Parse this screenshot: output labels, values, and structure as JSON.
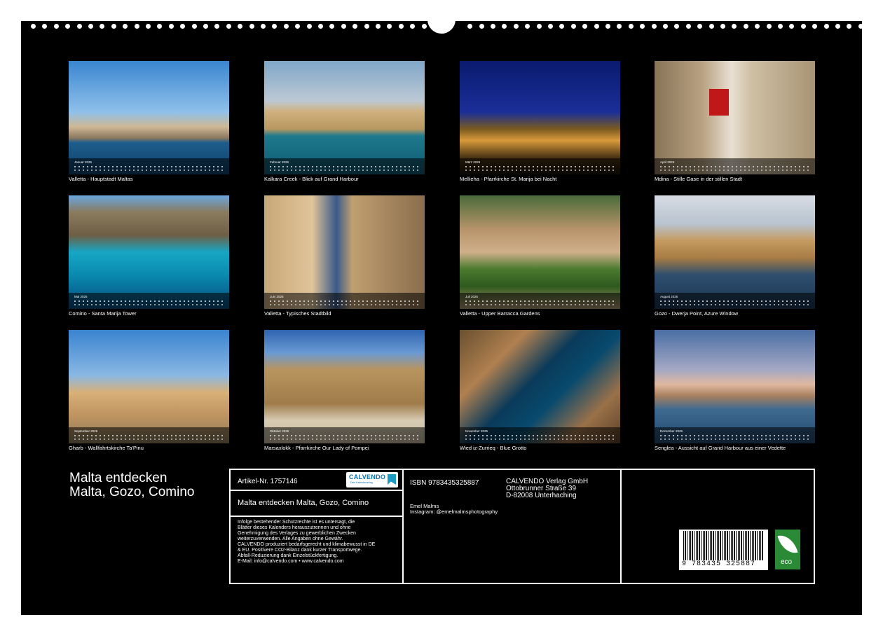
{
  "calendar": {
    "title_line1": "Malta entdecken",
    "title_line2": "Malta, Gozo, Comino",
    "images": [
      {
        "month": "Januar 2025",
        "caption": "Valletta - Hauptstadt Maltas"
      },
      {
        "month": "Februar 2025",
        "caption": "Kalkara Creek - Blick auf Grand Harbour"
      },
      {
        "month": "März 2025",
        "caption": "Mellieha - Pfarrkirche St. Marija bei Nacht"
      },
      {
        "month": "April 2025",
        "caption": "Mdina - Stille Gase in der stillen Stadt"
      },
      {
        "month": "Mai 2025",
        "caption": "Comino - Santa Marija Tower"
      },
      {
        "month": "Juni 2025",
        "caption": "Valletta - Typisches Stadtbild"
      },
      {
        "month": "Juli 2025",
        "caption": "Valletta - Upper Barracca Gardens"
      },
      {
        "month": "August 2025",
        "caption": "Gozo - Dwerja Point, Azure Window"
      },
      {
        "month": "September 2025",
        "caption": "Gharb - Wallfahrtskirche Ta'Pinu"
      },
      {
        "month": "Oktober 2025",
        "caption": "Marsaxlokk - Pfarrkirche Our Lady of Pompei"
      },
      {
        "month": "November 2025",
        "caption": "Wied iz-Zurrieq - Blue Grotto"
      },
      {
        "month": "Dezember 2025",
        "caption": "Senglea - Aussicht auf Grand Harbour aus einer Vedette"
      }
    ]
  },
  "info": {
    "article": "Artikel-Nr. 1757146",
    "logo_text": "CALVENDO",
    "logo_sub": "Dein Kalenderverlag",
    "product_title": "Malta entdecken Malta, Gozo, Comino",
    "legal": [
      "Infolge bestehender Schutzrechte ist es untersagt, die",
      "Blätter dieses Kalenders herauszutrennen und ohne",
      "Genehmigung des Verlages zu gewerblichen Zwecken",
      "weiterzuverwenden. Alle Angaben ohne Gewähr.",
      "CALVENDO produziert bedarfsgerecht und klimabewusst in DE",
      "& EU. Positivere CO2-Bilanz dank kurzer Transportwege.",
      "Abfall-Reduzierung dank Einzelstückfertigung.",
      "E-Mail: info@calvendo.com • www.calvendo.com"
    ],
    "isbn": "ISBN 9783435325887",
    "publisher": [
      "CALVENDO Verlag GmbH",
      "Ottobrunner Straße 39",
      "D-82008 Unterhaching"
    ],
    "author": "Emel Malms",
    "instagram": "Instagram: @emelmalmsphotography",
    "barcode_number": "9 783435 325887",
    "eco_label": "eco"
  },
  "colors": {
    "background": "#000000",
    "text": "#ffffff",
    "eco_green": "#2a8a35",
    "logo_blue": "#0a6fa8"
  }
}
